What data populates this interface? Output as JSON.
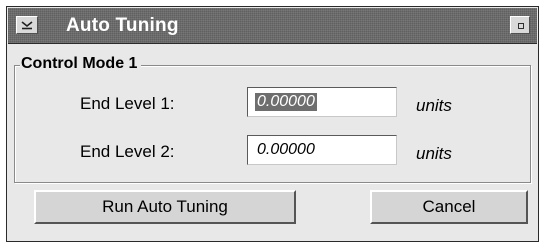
{
  "window": {
    "title": "Auto Tuning"
  },
  "group": {
    "title": "Control Mode 1",
    "fields": [
      {
        "label": "End Level 1:",
        "value": "0.00000",
        "units": "units",
        "selected": true
      },
      {
        "label": "End Level 2:",
        "value": "0.00000",
        "units": "units",
        "selected": false
      }
    ]
  },
  "buttons": {
    "run_label": "Run Auto Tuning",
    "cancel_label": "Cancel"
  },
  "colors": {
    "titlebar": "#6b6b6b",
    "window_bg": "#e8e8e8",
    "selection_bg": "#6e6e6e"
  },
  "icons": {
    "window_menu": "chevron-down-icon",
    "minimize": "minimize-icon"
  }
}
